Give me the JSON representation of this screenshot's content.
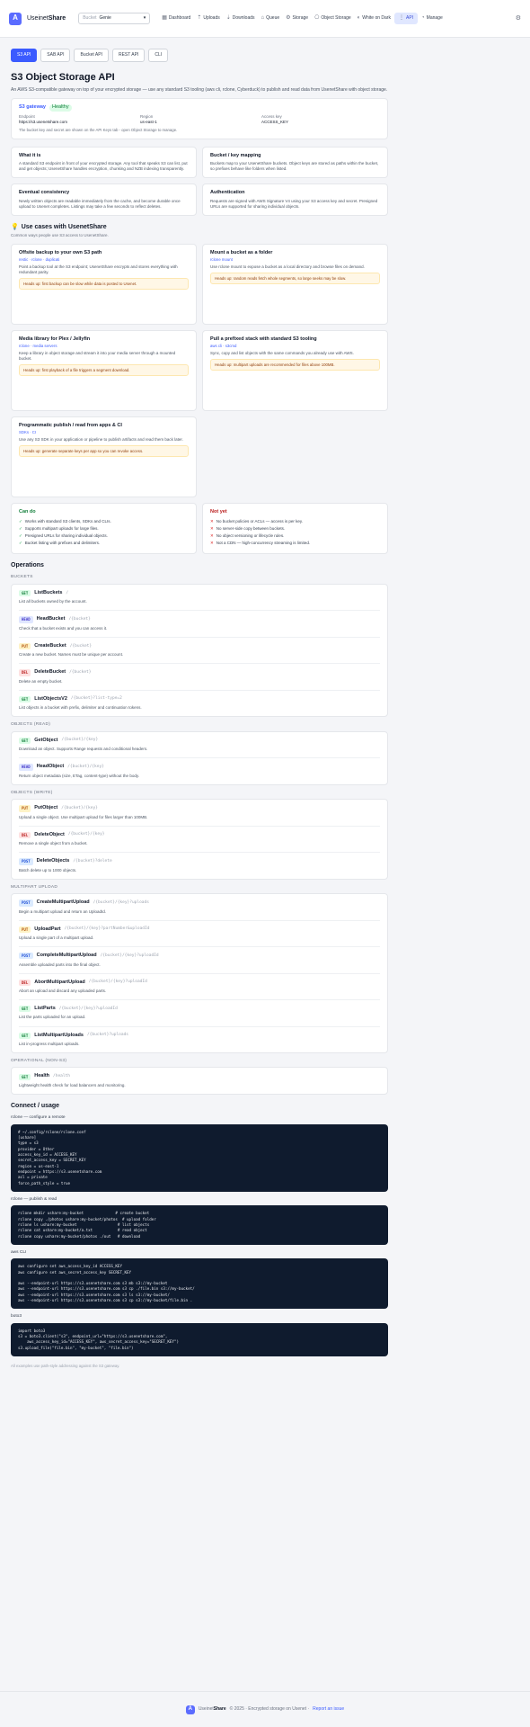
{
  "app": {
    "brand_light": "Useinet",
    "brand_bold": "Share",
    "logo_letter": "A"
  },
  "header": {
    "bucket_label": "Bucket",
    "bucket_value": "Genie",
    "nav": [
      {
        "icon": "▦",
        "label": "Dashboard"
      },
      {
        "icon": "⇡",
        "label": "Uploads"
      },
      {
        "icon": "⇣",
        "label": "Downloads"
      },
      {
        "icon": "⌂",
        "label": "Queue"
      },
      {
        "icon": "⚙",
        "label": "Storage"
      },
      {
        "icon": "⎔",
        "label": "Object Storage"
      },
      {
        "icon": "◐",
        "label": "White on Dark"
      },
      {
        "icon": "⋮",
        "label": "API"
      },
      {
        "icon": "◔",
        "label": "Manage"
      }
    ]
  },
  "tabs": [
    "S3 API",
    "SAB API",
    "Bucket API",
    "REST API",
    "CLI"
  ],
  "page": {
    "title": "S3 Object Storage API",
    "intro": "An AWS S3-compatible gateway on top of your encrypted storage — use any standard S3 tooling (aws cli, rclone, Cyberduck) to publish and read data from UsenetShare with object storage."
  },
  "endpoint": {
    "title": "S3 gateway",
    "badge": "Healthy",
    "fields": [
      {
        "k": "Endpoint",
        "v": "https://s3.usenetshare.com"
      },
      {
        "k": "Region",
        "v": "us-east-1"
      },
      {
        "k": "Access key",
        "v": "ACCESS_KEY"
      }
    ],
    "note": "The bucket key and secret are shown on the API Keys tab - open Object Storage to manage."
  },
  "info_cards": [
    {
      "title": "What it is",
      "text": "A standard S3 endpoint in front of your encrypted storage. Any tool that speaks S3 can list, put and get objects; UsenetShare handles encryption, chunking and NZB indexing transparently."
    },
    {
      "title": "Bucket / key mapping",
      "text": "Buckets map to your UsenetShare buckets. Object keys are stored as paths within the bucket, so prefixes behave like folders when listed."
    },
    {
      "title": "Eventual consistency",
      "text": "Newly written objects are readable immediately from the cache, and become durable once upload to Usenet completes. Listings may take a few seconds to reflect deletes."
    },
    {
      "title": "Authentication",
      "text": "Requests are signed with AWS Signature V4 using your S3 access key and secret. Presigned URLs are supported for sharing individual objects."
    }
  ],
  "use_cases": {
    "title": "Use cases with UsenetShare",
    "subtitle": "Common ways people use S3 access to UsenetShare.",
    "items": [
      {
        "title": "Offsite backup to your own S3 path",
        "tag": "restic · rclone · duplicati",
        "desc": "Point a backup tool at the S3 endpoint; UsenetShare encrypts and stores everything with redundant parity.",
        "warn": "Heads up: first backup can be slow while data is posted to Usenet."
      },
      {
        "title": "Mount a bucket as a folder",
        "tag": "rclone mount",
        "desc": "Use rclone mount to expose a bucket as a local directory and browse files on demand.",
        "warn": "Heads up: random reads fetch whole segments, so large seeks may be slow."
      },
      {
        "title": "Media library for Plex / Jellyfin",
        "tag": "rclone · media servers",
        "desc": "Keep a library in object storage and stream it into your media server through a mounted bucket.",
        "warn": "Heads up: first playback of a file triggers a segment download."
      },
      {
        "title": "Pull a prefixed stack with standard S3 tooling",
        "tag": "aws cli · s3cmd",
        "desc": "Sync, copy and list objects with the same commands you already use with AWS.",
        "warn": "Heads up: multipart uploads are recommended for files above 100MB."
      },
      {
        "title": "Programmatic publish / read from apps & CI",
        "tag": "SDKs · CI",
        "desc": "Use any S3 SDK in your application or pipeline to publish artifacts and read them back later.",
        "warn": "Heads up: generate separate keys per app so you can revoke access."
      }
    ]
  },
  "can": {
    "title": "Can do",
    "items": [
      "Works with standard S3 clients, SDKs and CLIs.",
      "Supports multipart uploads for large files.",
      "Presigned URLs for sharing individual objects.",
      "Bucket listing with prefixes and delimiters."
    ]
  },
  "cannot": {
    "title": "Not yet",
    "items": [
      "No bucket policies or ACLs — access is per key.",
      "No server-side copy between buckets.",
      "No object versioning or lifecycle rules.",
      "Not a CDN — high-concurrency streaming is limited."
    ]
  },
  "operations": {
    "title": "Operations",
    "groups": [
      {
        "label": "BUCKETS",
        "ops": [
          {
            "method": "GET",
            "name": "ListBuckets",
            "path": "/",
            "desc": "List all buckets owned by the account."
          },
          {
            "method": "HEAD",
            "name": "HeadBucket",
            "path": "/{bucket}",
            "desc": "Check that a bucket exists and you can access it."
          },
          {
            "method": "PUT",
            "name": "CreateBucket",
            "path": "/{bucket}",
            "desc": "Create a new bucket. Names must be unique per account."
          },
          {
            "method": "DEL",
            "name": "DeleteBucket",
            "path": "/{bucket}",
            "desc": "Delete an empty bucket."
          },
          {
            "method": "GET",
            "name": "ListObjectsV2",
            "path": "/{bucket}?list-type=2",
            "desc": "List objects in a bucket with prefix, delimiter and continuation tokens."
          }
        ]
      },
      {
        "label": "OBJECTS (READ)",
        "ops": [
          {
            "method": "GET",
            "name": "GetObject",
            "path": "/{bucket}/{key}",
            "desc": "Download an object. Supports Range requests and conditional headers."
          },
          {
            "method": "HEAD",
            "name": "HeadObject",
            "path": "/{bucket}/{key}",
            "desc": "Return object metadata (size, ETag, content-type) without the body."
          }
        ]
      },
      {
        "label": "OBJECTS (WRITE)",
        "ops": [
          {
            "method": "PUT",
            "name": "PutObject",
            "path": "/{bucket}/{key}",
            "desc": "Upload a single object. Use multipart upload for files larger than 100MB."
          },
          {
            "method": "DEL",
            "name": "DeleteObject",
            "path": "/{bucket}/{key}",
            "desc": "Remove a single object from a bucket."
          },
          {
            "method": "POST",
            "name": "DeleteObjects",
            "path": "/{bucket}?delete",
            "desc": "Batch delete up to 1000 objects."
          }
        ]
      },
      {
        "label": "MULTIPART UPLOAD",
        "ops": [
          {
            "method": "POST",
            "name": "CreateMultipartUpload",
            "path": "/{bucket}/{key}?uploads",
            "desc": "Begin a multipart upload and return an UploadId."
          },
          {
            "method": "PUT",
            "name": "UploadPart",
            "path": "/{bucket}/{key}?partNumber&uploadId",
            "desc": "Upload a single part of a multipart upload."
          },
          {
            "method": "POST",
            "name": "CompleteMultipartUpload",
            "path": "/{bucket}/{key}?uploadId",
            "desc": "Assemble uploaded parts into the final object."
          },
          {
            "method": "DEL",
            "name": "AbortMultipartUpload",
            "path": "/{bucket}/{key}?uploadId",
            "desc": "Abort an upload and discard any uploaded parts."
          },
          {
            "method": "GET",
            "name": "ListParts",
            "path": "/{bucket}/{key}?uploadId",
            "desc": "List the parts uploaded for an upload."
          },
          {
            "method": "GET",
            "name": "ListMultipartUploads",
            "path": "/{bucket}?uploads",
            "desc": "List in-progress multipart uploads."
          }
        ]
      },
      {
        "label": "OPERATIONAL (NON-S3)",
        "ops": [
          {
            "method": "GET",
            "name": "Health",
            "path": "/health",
            "desc": "Lightweight health check for load balancers and monitoring."
          }
        ]
      }
    ]
  },
  "connect": {
    "title": "Connect / usage",
    "blocks": [
      {
        "label": "rclone — configure a remote",
        "code": "# ~/.config/rclone/rclone.conf\n[ushare]\ntype = s3\nprovider = Other\naccess_key_id = ACCESS_KEY\nsecret_access_key = SECRET_KEY\nregion = us-east-1\nendpoint = https://s3.usenetshare.com\nacl = private\nforce_path_style = true"
      },
      {
        "label": "rclone — publish & read",
        "code": "rclone mkdir ushare:my-bucket              # create bucket\nrclone copy ./photos ushare:my-bucket/photos  # upload folder\nrclone ls ushare:my-bucket                  # list objects\nrclone cat ushare:my-bucket/a.txt           # read object\nrclone copy ushare:my-bucket/photos ./out   # download"
      },
      {
        "label": "aws CLI",
        "code": "aws configure set aws_access_key_id ACCESS_KEY\naws configure set aws_secret_access_key SECRET_KEY\n\naws --endpoint-url https://s3.usenetshare.com s3 mb s3://my-bucket\naws --endpoint-url https://s3.usenetshare.com s3 cp ./file.bin s3://my-bucket/\naws --endpoint-url https://s3.usenetshare.com s3 ls s3://my-bucket/\naws --endpoint-url https://s3.usenetshare.com s3 cp s3://my-bucket/file.bin ."
      },
      {
        "label": "boto3",
        "code": "import boto3\ns3 = boto3.client(\"s3\", endpoint_url=\"https://s3.usenetshare.com\",\n    aws_access_key_id=\"ACCESS_KEY\", aws_secret_access_key=\"SECRET_KEY\")\ns3.upload_file(\"file.bin\", \"my-bucket\", \"file.bin\")"
      }
    ],
    "note": "All examples use path-style addressing against the S3 gateway."
  },
  "footer": {
    "brand_light": "Useinet",
    "brand_bold": "Share",
    "text": "© 2025 · Encrypted storage on Usenet ·",
    "link": "Report an issue"
  }
}
